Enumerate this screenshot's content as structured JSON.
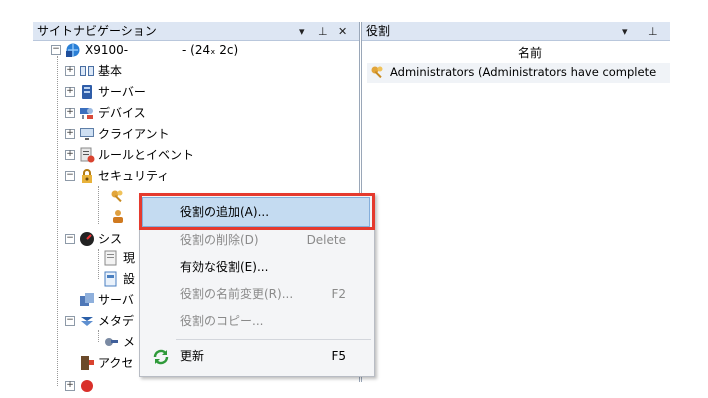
{
  "left_pane": {
    "title": "サイトナビゲーション",
    "controls": {
      "dropdown": "▾",
      "pin": "⊥",
      "close": "✕"
    },
    "root": {
      "prefix": "X9100-",
      "suffix": "- (24ₓ 2c)"
    },
    "items": [
      {
        "label": "基本"
      },
      {
        "label": "サーバー"
      },
      {
        "label": "デバイス"
      },
      {
        "label": "クライアント"
      },
      {
        "label": "ルールとイベント"
      },
      {
        "label": "セキュリティ"
      }
    ],
    "partial_labels": [
      "シス",
      "現",
      "設",
      "サーバ",
      "メタデ",
      "メ",
      "アクセ"
    ]
  },
  "right_pane": {
    "title": "役割",
    "controls": {
      "dropdown": "▾",
      "pin": "⊥"
    },
    "column_header": "名前",
    "rows": [
      {
        "label": "Administrators (Administrators have complete"
      }
    ]
  },
  "context_menu": {
    "items": [
      {
        "label": "役割の追加(A)...",
        "shortcut": "",
        "enabled": true
      },
      {
        "label": "役割の削除(D)",
        "shortcut": "Delete",
        "enabled": false
      },
      {
        "label": "有効な役割(E)...",
        "shortcut": "",
        "enabled": true
      },
      {
        "label": "役割の名前変更(R)...",
        "shortcut": "F2",
        "enabled": false
      },
      {
        "label": "役割のコピー...",
        "shortcut": "",
        "enabled": false
      },
      {
        "label": "更新",
        "shortcut": "F5",
        "enabled": true
      }
    ]
  },
  "colors": {
    "highlight_border": "#e53a2e",
    "header_bg": "#dde6f3",
    "menu_hover": "#c4dbf1"
  }
}
